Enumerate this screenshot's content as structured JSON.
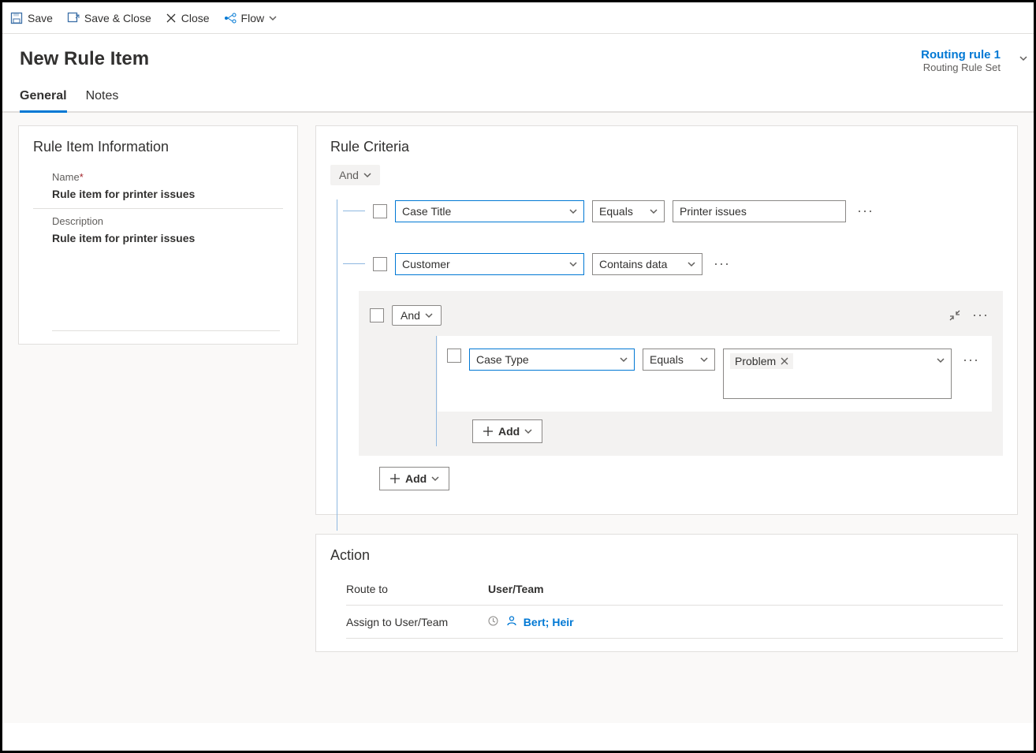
{
  "commandBar": {
    "save": "Save",
    "saveClose": "Save & Close",
    "close": "Close",
    "flow": "Flow"
  },
  "header": {
    "title": "New Rule Item",
    "contextLink": "Routing rule 1",
    "contextSub": "Routing Rule Set"
  },
  "tabs": {
    "general": "General",
    "notes": "Notes"
  },
  "ruleItemInfo": {
    "sectionTitle": "Rule Item Information",
    "nameLabel": "Name",
    "nameValue": "Rule item for printer issues",
    "descriptionLabel": "Description",
    "descriptionValue": "Rule item for printer issues"
  },
  "criteria": {
    "sectionTitle": "Rule Criteria",
    "rootOperator": "And",
    "rows": [
      {
        "field": "Case Title",
        "operator": "Equals",
        "value": "Printer issues"
      },
      {
        "field": "Customer",
        "operator": "Contains data"
      }
    ],
    "nested": {
      "operator": "And",
      "row": {
        "field": "Case Type",
        "operator": "Equals",
        "value": "Problem"
      },
      "addLabel": "Add"
    },
    "addLabel": "Add"
  },
  "action": {
    "sectionTitle": "Action",
    "routeToLabel": "Route to",
    "routeToValue": "User/Team",
    "assignLabel": "Assign to User/Team",
    "assignValue": "Bert; Heir"
  }
}
